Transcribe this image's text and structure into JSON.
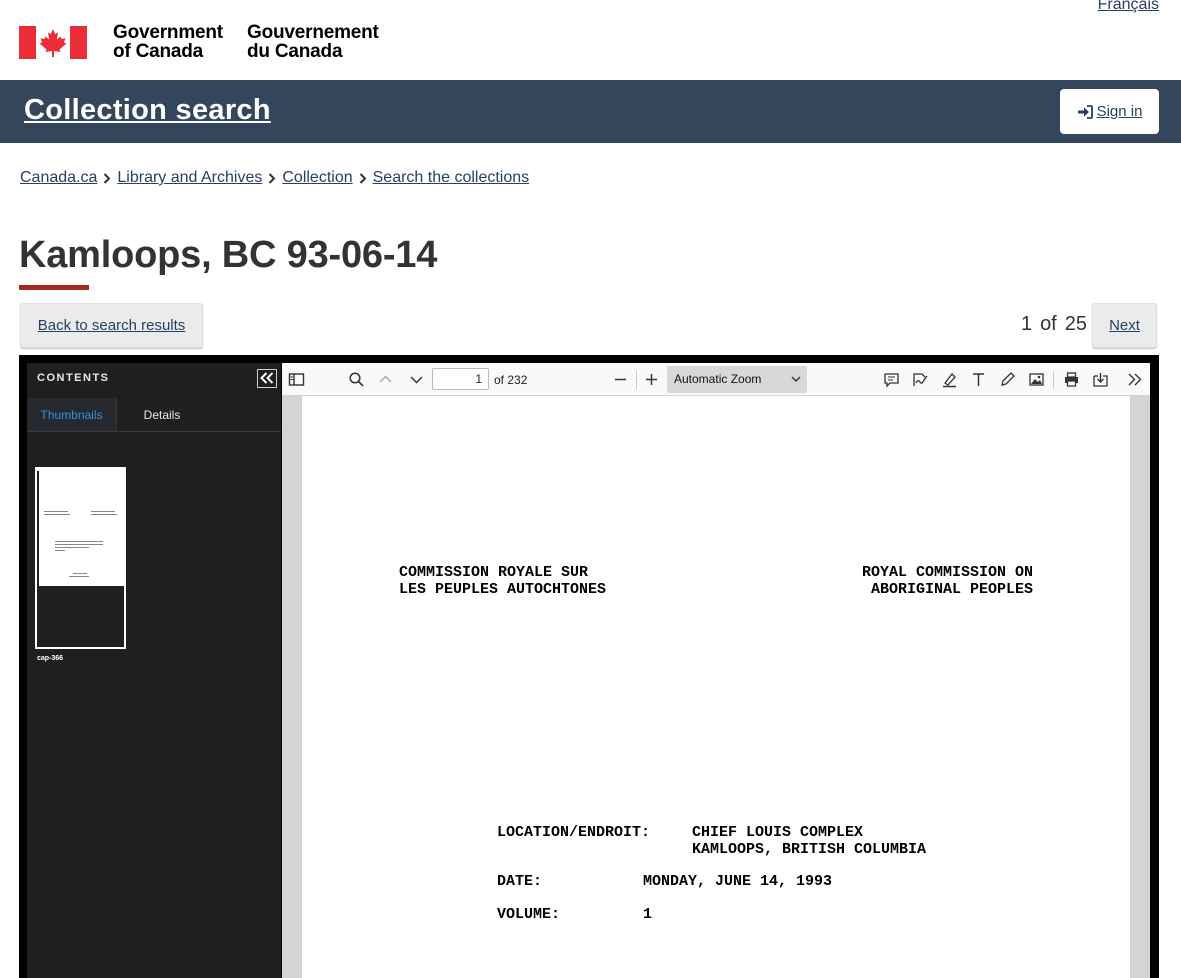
{
  "header": {
    "language_link": "Français",
    "signature_en": [
      "Government",
      "of Canada"
    ],
    "signature_fr": [
      "Gouvernement",
      "du Canada"
    ]
  },
  "appbar": {
    "title": "Collection search",
    "signin_label": "Sign in"
  },
  "breadcrumb": {
    "items": [
      "Canada.ca",
      "Library and Archives",
      "Collection",
      "Search the collections"
    ]
  },
  "page": {
    "title": "Kamloops, BC 93-06-14",
    "back_label": "Back to search results",
    "pager_current": "1",
    "pager_of": "of",
    "pager_total": "25",
    "next_label": "Next"
  },
  "viewer": {
    "sidebar_title": "CONTENTS",
    "tabs": [
      "Thumbnails",
      "Details"
    ],
    "thumbnail_caption": "cap-366",
    "page_number": "1",
    "page_count_label": "of 232",
    "zoom_label": "Automatic Zoom",
    "document": {
      "left_heading": [
        "COMMISSION ROYALE SUR",
        "LES PEUPLES AUTOCHTONES"
      ],
      "right_heading": [
        "ROYAL COMMISSION ON",
        "ABORIGINAL PEOPLES"
      ],
      "location_label": "LOCATION/ENDROIT:",
      "location_value": [
        "CHIEF LOUIS COMPLEX",
        "KAMLOOPS, BRITISH COLUMBIA"
      ],
      "date_label": "DATE:",
      "date_value": "MONDAY, JUNE 14, 1993",
      "volume_label": "VOLUME:",
      "volume_value": "1"
    }
  },
  "colors": {
    "appbar_bg": "#33465c",
    "link": "#284162",
    "title_rule": "#a62a1e",
    "flag_red": "#eb2d37"
  }
}
